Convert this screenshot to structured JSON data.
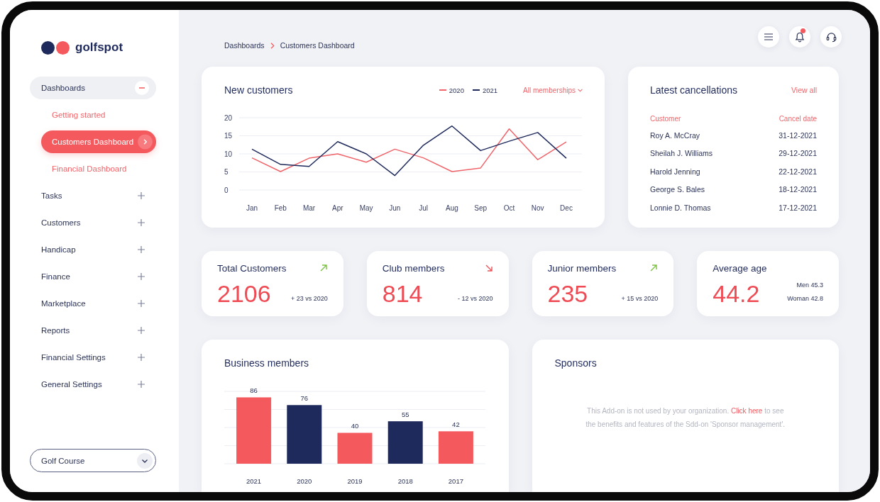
{
  "sidebar": {
    "brand": "golfspot",
    "nav": [
      {
        "label": "Dashboards",
        "expanded": true,
        "children": [
          {
            "label": "Getting started",
            "selected": false
          },
          {
            "label": "Customers Dashboard",
            "selected": true
          },
          {
            "label": "Financial Dashboard",
            "selected": false
          }
        ]
      },
      {
        "label": "Tasks",
        "expanded": false
      },
      {
        "label": "Customers",
        "expanded": false
      },
      {
        "label": "Handicap",
        "expanded": false
      },
      {
        "label": "Finance",
        "expanded": false
      },
      {
        "label": "Marketplace",
        "expanded": false
      },
      {
        "label": "Reports",
        "expanded": false
      },
      {
        "label": "Financial Settings",
        "expanded": false
      },
      {
        "label": "General Settings",
        "expanded": false
      }
    ],
    "course_select": {
      "value": "Golf Course"
    }
  },
  "header": {
    "breadcrumb": [
      "Dashboards",
      "Customers Dashboard"
    ],
    "notifications": {
      "unread": true
    }
  },
  "new_customers": {
    "title": "New customers",
    "filter": "All memberships",
    "chart_data": {
      "type": "line",
      "categories": [
        "Jan",
        "Feb",
        "Mar",
        "Apr",
        "May",
        "Jun",
        "Jul",
        "Aug",
        "Sep",
        "Oct",
        "Nov",
        "Dec"
      ],
      "series": [
        {
          "name": "2020",
          "color": "#f0646a",
          "values": [
            8.9,
            5.1,
            8.8,
            10,
            7.7,
            11.3,
            8.9,
            5.1,
            6.1,
            16.9,
            8.4,
            13.3
          ]
        },
        {
          "name": "2021",
          "color": "#1f2a5c",
          "values": [
            11.3,
            7.1,
            6.5,
            13.4,
            10,
            4,
            12.4,
            17.7,
            10.9,
            13.5,
            15.9,
            8.8
          ]
        }
      ],
      "ylim": [
        0,
        20
      ],
      "yticks": [
        0,
        5,
        10,
        15,
        20
      ],
      "grid": true
    }
  },
  "cancellations": {
    "title": "Latest cancellations",
    "link": "View all",
    "columns": [
      "Customer",
      "Cancel date"
    ],
    "rows": [
      [
        "Roy A. McCray",
        "31-12-2021"
      ],
      [
        "Sheilah J. Williams",
        "29-12-2021"
      ],
      [
        "Harold Jenning",
        "22-12-2021"
      ],
      [
        "George S. Bales",
        "18-12-2021"
      ],
      [
        "Lonnie D. Thomas",
        "17-12-2021"
      ]
    ]
  },
  "stats": [
    {
      "kind": "trend",
      "title": "Total Customers",
      "value": "2106",
      "rising": true,
      "change": "+ 23 vs 2020"
    },
    {
      "kind": "trend",
      "title": "Club members",
      "value": "814",
      "rising": false,
      "change": "- 12 vs 2020"
    },
    {
      "kind": "trend",
      "title": "Junior members",
      "value": "235",
      "rising": true,
      "change": "+ 15 vs 2020"
    },
    {
      "kind": "split",
      "title": "Average age",
      "value": "44.2",
      "breakdown": [
        "Men 45.3",
        "Woman 42.8"
      ]
    }
  ],
  "business_members": {
    "title": "Business members",
    "chart_data": {
      "type": "bar",
      "categories": [
        "2021",
        "2020",
        "2019",
        "2018",
        "2017"
      ],
      "values": [
        86,
        76,
        40,
        55,
        42
      ],
      "colors": [
        "#f4595e",
        "#1f2a5c",
        "#f4595e",
        "#1f2a5c",
        "#f4595e"
      ],
      "data_labels": true,
      "grid": true
    }
  },
  "sponsors": {
    "title": "Sponsors",
    "message": {
      "before": "This Add-on is not used by your organization. ",
      "link": "Click here",
      "after": " to see the benefits and features of the Sdd-on 'Sponsor management'."
    }
  }
}
